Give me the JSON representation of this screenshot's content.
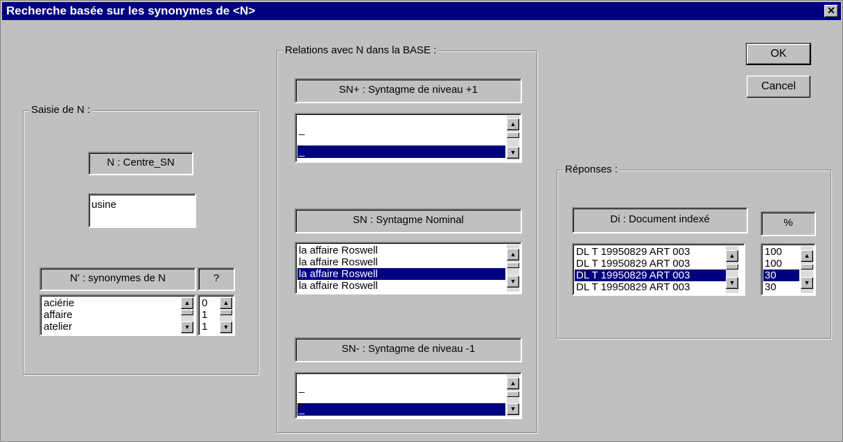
{
  "window": {
    "title": "Recherche basée sur les synonymes de <N>",
    "close_glyph": "✕"
  },
  "buttons": {
    "ok": "OK",
    "cancel": "Cancel"
  },
  "saisie": {
    "legend": "Saisie de N :",
    "n_header": "N : Centre_SN",
    "n_value": "usine",
    "syn_header": "N' : synonymes de N",
    "q_header": "?",
    "synonyms": [
      "aciérie",
      "affaire",
      "atelier"
    ],
    "scores": [
      "0",
      "1",
      "1"
    ]
  },
  "relations": {
    "legend": "Relations avec N dans la BASE :",
    "snplus_header": "SN+ : Syntagme de niveau +1",
    "snplus_items": [
      "_",
      "_",
      "_"
    ],
    "sn_header": "SN : Syntagme Nominal",
    "sn_items": [
      "la affaire Roswell",
      "la affaire Roswell",
      "la affaire Roswell",
      "la affaire Roswell"
    ],
    "snminus_header": "SN- : Syntagme de niveau -1",
    "snminus_items": [
      "_",
      "_",
      "_"
    ]
  },
  "reponses": {
    "legend": "Réponses :",
    "doc_header": "Di : Document indexé",
    "pct_header": "%",
    "docs": [
      "DL T 19950829 ART 003",
      "DL T 19950829 ART 003",
      "DL T 19950829 ART 003",
      "DL T 19950829 ART 003"
    ],
    "pcts": [
      "100",
      "100",
      "30",
      "30"
    ]
  },
  "icons": {
    "up": "▲",
    "down": "▼"
  },
  "colors": {
    "selection": "#000080",
    "face": "#c0c0c0",
    "title_bar": "#000080"
  }
}
